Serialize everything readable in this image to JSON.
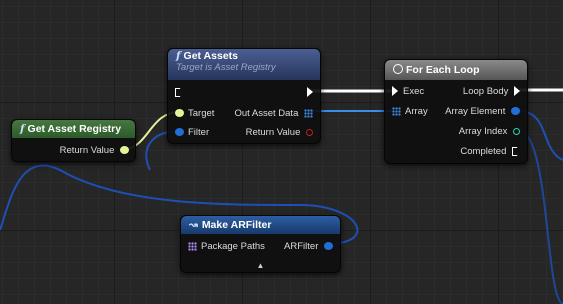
{
  "nodes": {
    "get_asset_registry": {
      "title": "Get Asset Registry",
      "icon": "function-icon",
      "header_color": "#3d6e3a",
      "pins": {
        "return_value": "Return Value"
      }
    },
    "get_assets": {
      "title": "Get Assets",
      "subtitle": "Target is Asset Registry",
      "icon": "function-icon",
      "header_color": "#3a4e7a",
      "pins": {
        "target": "Target",
        "filter": "Filter",
        "out_asset_data": "Out Asset Data",
        "return_value": "Return Value"
      }
    },
    "for_each_loop": {
      "title": "For Each Loop",
      "icon": "loop-icon",
      "header_color": "#777777",
      "pins": {
        "exec": "Exec",
        "array": "Array",
        "loop_body": "Loop Body",
        "array_element": "Array Element",
        "array_index": "Array Index",
        "completed": "Completed"
      }
    },
    "make_arfilter": {
      "title": "Make ARFilter",
      "icon": "make-struct-icon",
      "header_color": "#244d86",
      "pins": {
        "package_paths": "Package Paths",
        "arfilter": "ARFilter"
      },
      "expand_glyph": "▲"
    }
  },
  "colors": {
    "object_pin": "#e6f29a",
    "struct_pin": "#1f6fd6",
    "array_pin": "#3a8ee6",
    "bool_pin": "#c0201e",
    "int_pin": "#2ad8b0",
    "name_array_pin": "#b58cff",
    "exec_wire": "#ffffff"
  }
}
